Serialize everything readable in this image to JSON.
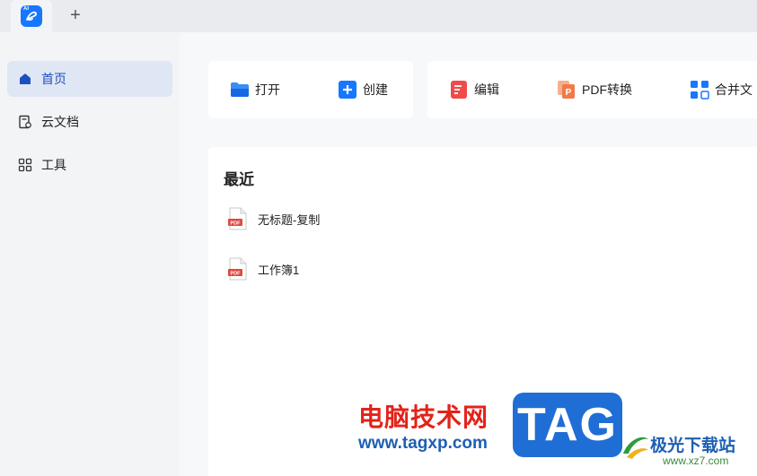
{
  "titlebar": {
    "app_logo_text": "AI",
    "new_tab_label": "+"
  },
  "sidebar": {
    "items": [
      {
        "label": "首页",
        "icon": "home-icon"
      },
      {
        "label": "云文档",
        "icon": "cloud-doc-icon"
      },
      {
        "label": "工具",
        "icon": "tools-grid-icon"
      }
    ]
  },
  "actions": {
    "open_label": "打开",
    "create_label": "创建",
    "edit_label": "编辑",
    "convert_label": "PDF转换",
    "merge_label": "合并文"
  },
  "recent": {
    "title": "最近",
    "files": [
      {
        "name": "无标题-复制",
        "badge": "PDF"
      },
      {
        "name": "工作簿1",
        "badge": "PDF"
      }
    ]
  },
  "watermark": {
    "cn_text": "电脑技术网",
    "url": "www.tagxp.com",
    "tag": "TAG",
    "site_name": "极光下载站",
    "site_url": "www.xz7.com"
  },
  "colors": {
    "accent": "#1677ff",
    "edit": "#ef4b4b",
    "convert": "#f07a4a"
  }
}
